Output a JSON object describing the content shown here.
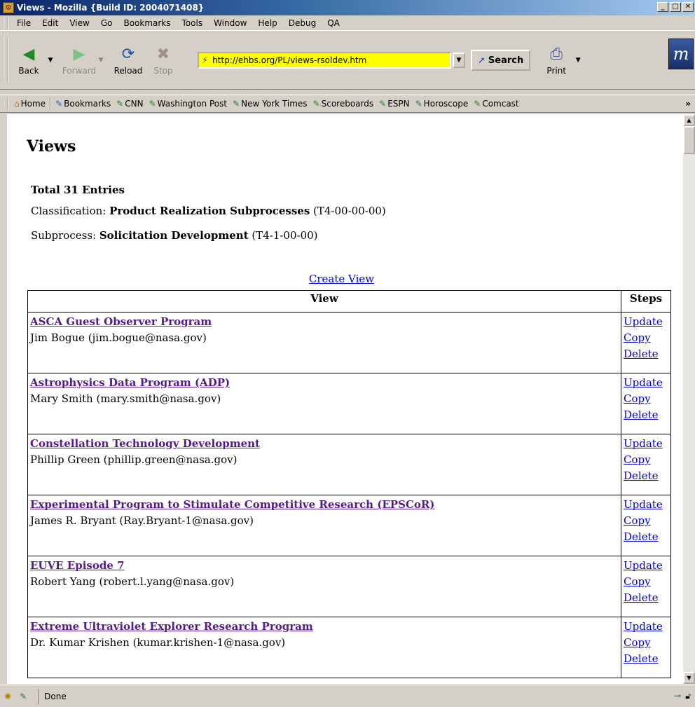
{
  "window": {
    "title": "Views - Mozilla {Build ID: 2004071408}"
  },
  "menu": [
    "File",
    "Edit",
    "View",
    "Go",
    "Bookmarks",
    "Tools",
    "Window",
    "Help",
    "Debug",
    "QA"
  ],
  "toolbar": {
    "back": "Back",
    "forward": "Forward",
    "reload": "Reload",
    "stop": "Stop",
    "url": "http://ehbs.org/PL/views-rsoldev.htm",
    "search": "Search",
    "print": "Print"
  },
  "bookmarks": [
    "Home",
    "Bookmarks",
    "CNN",
    "Washington Post",
    "New York Times",
    "Scoreboards",
    "ESPN",
    "Horoscope",
    "Comcast"
  ],
  "page": {
    "title": "Views",
    "total": "Total 31  Entries",
    "classification_label": "Classification: ",
    "classification_value": "Product Realization Subprocesses",
    "classification_code": " (T4-00-00-00)",
    "subprocess_label": "Subprocess: ",
    "subprocess_value": "Solicitation Development",
    "subprocess_code": "  (T4-1-00-00)",
    "create_view": "Create View",
    "col_view": "View",
    "col_steps": "Steps",
    "step_update": "Update",
    "step_copy": "Copy",
    "step_delete": "Delete",
    "rows": [
      {
        "name": "ASCA Guest Observer Program",
        "owner": "Jim Bogue (jim.bogue@nasa.gov)"
      },
      {
        "name": "Astrophysics Data Program (ADP)",
        "owner": "Mary Smith (mary.smith@nasa.gov)"
      },
      {
        "name": "Constellation Technology Development",
        "owner": "Phillip Green (phillip.green@nasa.gov)"
      },
      {
        "name": "Experimental Program to Stimulate Competitive Research (EPSCoR)",
        "owner": "James R. Bryant (Ray.Bryant-1@nasa.gov)"
      },
      {
        "name": "EUVE Episode 7",
        "owner": "Robert Yang (robert.l.yang@nasa.gov)"
      },
      {
        "name": "Extreme Ultraviolet Explorer Research Program",
        "owner": "Dr. Kumar Krishen (kumar.krishen-1@nasa.gov)"
      }
    ]
  },
  "status": {
    "text": "Done"
  }
}
